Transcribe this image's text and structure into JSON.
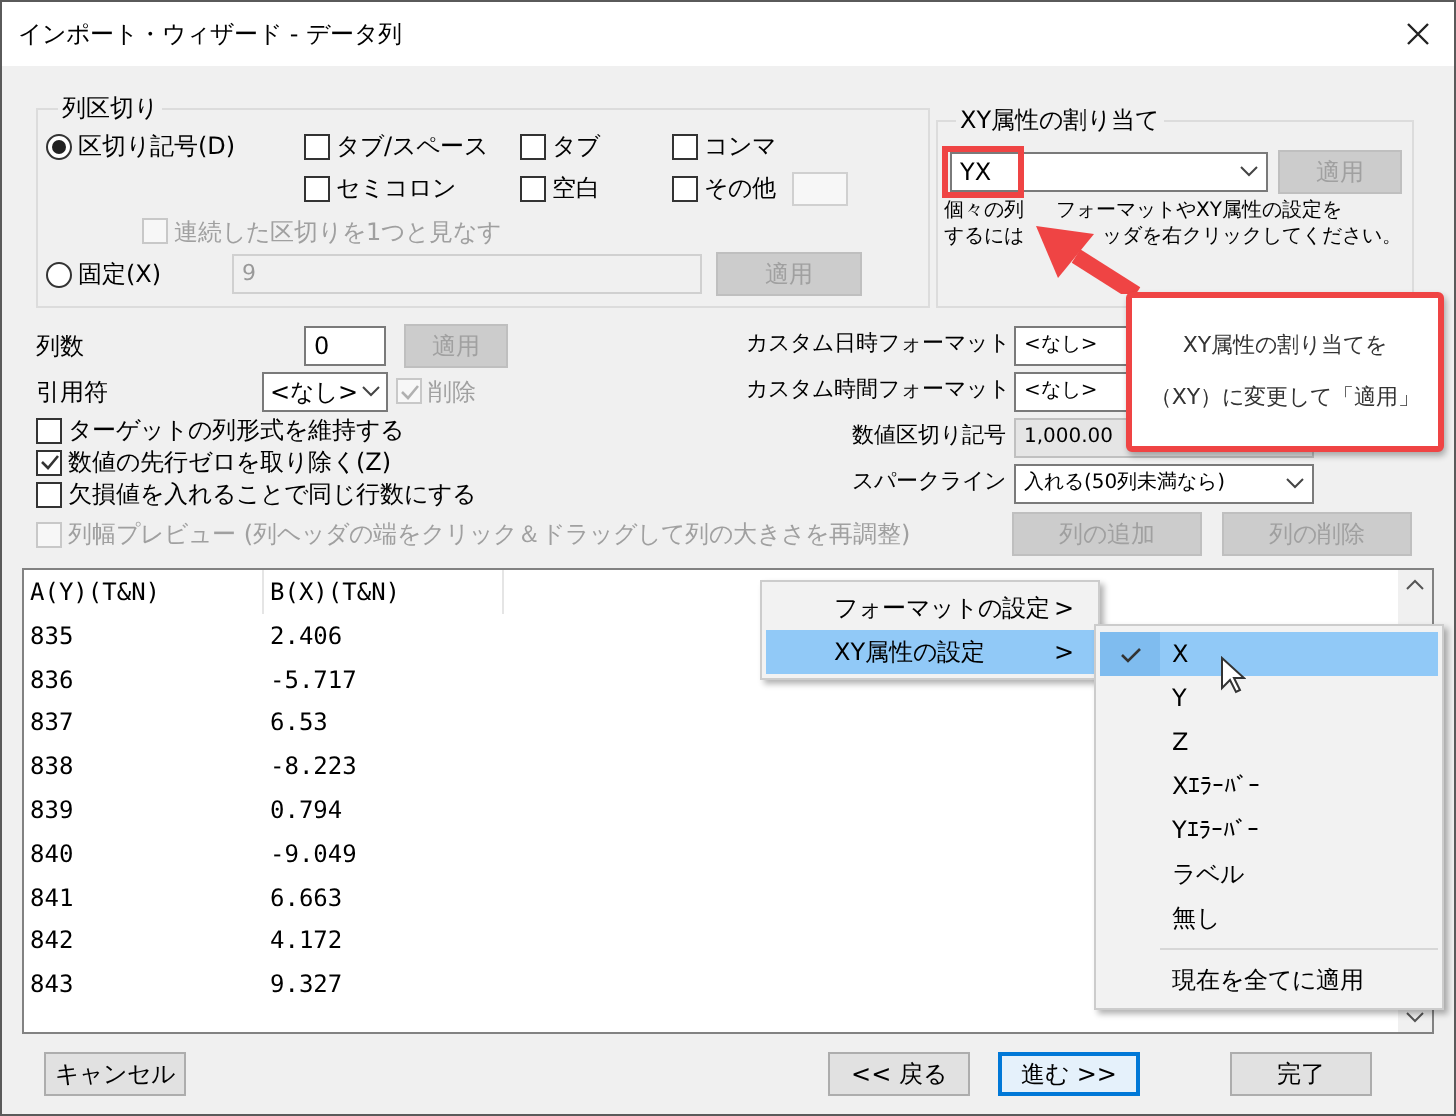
{
  "window": {
    "title": "インポート・ウィザード - データ列"
  },
  "delimiter_group": {
    "title": "列区切り",
    "modes": [
      {
        "label": "区切り記号(D)",
        "selected": true
      },
      {
        "label": "固定(X)",
        "selected": false
      }
    ],
    "checkboxes": [
      {
        "label": "タブ/スペース",
        "checked": false
      },
      {
        "label": "タブ",
        "checked": false
      },
      {
        "label": "コンマ",
        "checked": false
      },
      {
        "label": "セミコロン",
        "checked": false
      },
      {
        "label": "空白",
        "checked": false
      },
      {
        "label": "その他",
        "checked": false
      }
    ],
    "merge": {
      "label": "連続した区切りを1つと見なす",
      "checked": false,
      "disabled": true
    },
    "fixed_value": "9",
    "apply": {
      "label": "適用",
      "disabled": true
    }
  },
  "xy_group": {
    "title": "XY属性の割り当て",
    "value": "YX",
    "apply": {
      "label": "適用",
      "disabled": true
    },
    "hint_lines": [
      [
        "個々の列",
        "フォーマットやXY属性の設定を"
      ],
      [
        "するには",
        "ッダを右クリックしてください。"
      ]
    ]
  },
  "column_count": {
    "label": "列数",
    "value": "0",
    "apply": {
      "label": "適用",
      "disabled": true
    }
  },
  "quote": {
    "label": "引用符",
    "value": "<なし>",
    "remove": {
      "label": "削除",
      "checked": true,
      "disabled": true
    }
  },
  "options": [
    {
      "label": "ターゲットの列形式を維持する",
      "checked": false,
      "disabled": false
    },
    {
      "label": "数値の先行ゼロを取り除く(Z)",
      "checked": true,
      "disabled": false
    },
    {
      "label": "欠損値を入れることで同じ行数にする",
      "checked": false,
      "disabled": false
    },
    {
      "label": "列幅プレビュー (列ヘッダの端をクリック＆ドラッグして列の大きさを再調整)",
      "checked": false,
      "disabled": true
    }
  ],
  "formats": [
    {
      "label": "カスタム日時フォーマット",
      "value": "<なし>",
      "kind": "field",
      "disabled": false
    },
    {
      "label": "カスタム時間フォーマット",
      "value": "<なし>",
      "kind": "field",
      "disabled": false
    },
    {
      "label": "数値区切り記号",
      "value": "1,000.00",
      "kind": "field",
      "disabled": true
    },
    {
      "label": "スパークライン",
      "value": "入れる(50列未満なら)",
      "kind": "dropdown",
      "disabled": false
    }
  ],
  "column_buttons": [
    {
      "label": "列の追加",
      "disabled": true
    },
    {
      "label": "列の削除",
      "disabled": true
    }
  ],
  "preview": {
    "columns": [
      "A(Y)(T&N)",
      "B(X)(T&N)"
    ],
    "rows": [
      [
        "835",
        "2.406"
      ],
      [
        "836",
        "-5.717"
      ],
      [
        "837",
        "6.53"
      ],
      [
        "838",
        "-8.223"
      ],
      [
        "839",
        "0.794"
      ],
      [
        "840",
        "-9.049"
      ],
      [
        "841",
        "6.663"
      ],
      [
        "842",
        "4.172"
      ],
      [
        "843",
        "9.327"
      ]
    ]
  },
  "context_menu": {
    "items": [
      {
        "label": "フォーマットの設定",
        "arrow": ">",
        "selected": false
      },
      {
        "label": "XY属性の設定",
        "arrow": ">",
        "selected": true
      }
    ]
  },
  "submenu": {
    "items": [
      {
        "label": "X",
        "kind": "option",
        "checked": true,
        "selected": true
      },
      {
        "label": "Y",
        "kind": "option",
        "checked": false,
        "selected": false
      },
      {
        "label": "Z",
        "kind": "option",
        "checked": false,
        "selected": false
      },
      {
        "label": "Xｴﾗｰﾊﾞｰ",
        "kind": "option",
        "checked": false,
        "selected": false
      },
      {
        "label": "Yｴﾗｰﾊﾞｰ",
        "kind": "option",
        "checked": false,
        "selected": false
      },
      {
        "label": "ラベル",
        "kind": "option",
        "checked": false,
        "selected": false
      },
      {
        "label": "無し",
        "kind": "option",
        "checked": false,
        "selected": false
      },
      {
        "label": "現在を全てに適用",
        "kind": "action",
        "checked": false,
        "selected": false
      }
    ]
  },
  "callout": {
    "lines": [
      "XY属性の割り当てを",
      "（XY）に変更して「適用」"
    ]
  },
  "buttons": [
    {
      "label": "キャンセル",
      "focused": false
    },
    {
      "label": "<< 戻る",
      "focused": false
    },
    {
      "label": "進む >>",
      "focused": true
    },
    {
      "label": "完了",
      "focused": false
    }
  ]
}
